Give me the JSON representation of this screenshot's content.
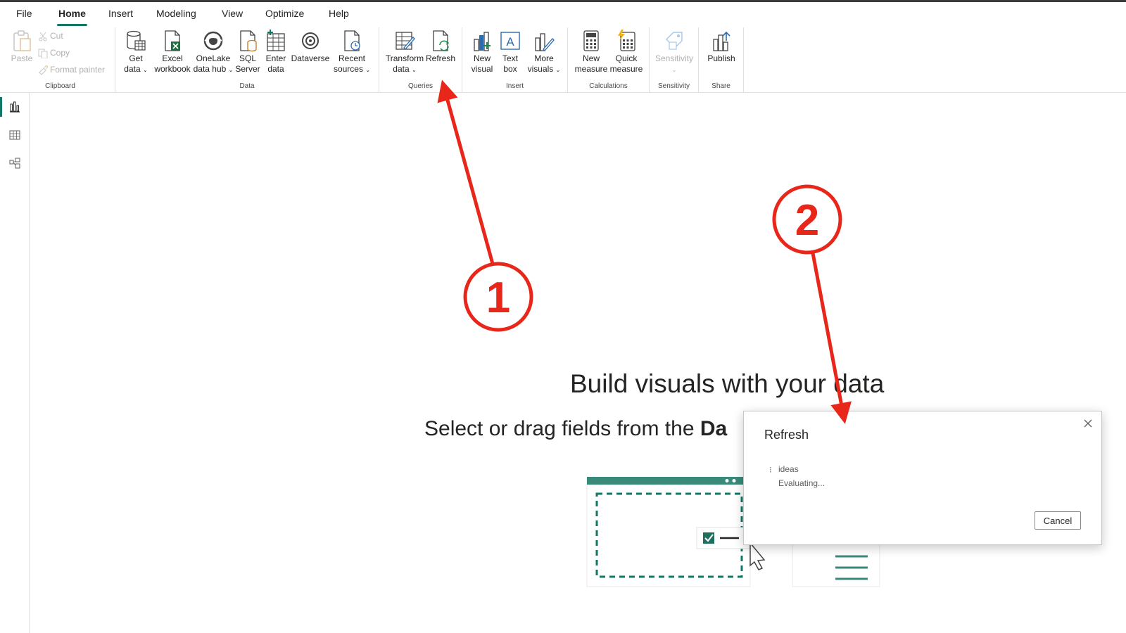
{
  "menu": {
    "tabs": [
      "File",
      "Home",
      "Insert",
      "Modeling",
      "View",
      "Optimize",
      "Help"
    ],
    "active": "Home"
  },
  "ribbon": {
    "clipboard": {
      "group": "Clipboard",
      "paste": "Paste",
      "cut": "Cut",
      "copy": "Copy",
      "format_painter": "Format painter"
    },
    "data": {
      "group": "Data",
      "get_data": [
        "Get",
        "data"
      ],
      "excel": [
        "Excel",
        "workbook"
      ],
      "onelake": [
        "OneLake",
        "data hub"
      ],
      "sql": [
        "SQL",
        "Server"
      ],
      "enter": [
        "Enter",
        "data"
      ],
      "dataverse": "Dataverse",
      "recent": [
        "Recent",
        "sources"
      ]
    },
    "queries": {
      "group": "Queries",
      "transform": [
        "Transform",
        "data"
      ],
      "refresh": "Refresh"
    },
    "insert": {
      "group": "Insert",
      "new_visual": [
        "New",
        "visual"
      ],
      "text_box": [
        "Text",
        "box"
      ],
      "more_visuals": [
        "More",
        "visuals"
      ]
    },
    "calculations": {
      "group": "Calculations",
      "new_measure": [
        "New",
        "measure"
      ],
      "quick_measure": [
        "Quick",
        "measure"
      ]
    },
    "sensitivity": {
      "group": "Sensitivity",
      "label": "Sensitivity"
    },
    "share": {
      "group": "Share",
      "publish": "Publish"
    }
  },
  "canvas": {
    "headline": "Build visuals with your data",
    "subline_prefix": "Select or drag fields from the ",
    "subline_bold": "Da"
  },
  "dialog": {
    "title": "Refresh",
    "spinner": "⁝",
    "query": "ideas",
    "status": "Evaluating...",
    "cancel": "Cancel"
  },
  "annotations": [
    "1",
    "2"
  ],
  "colors": {
    "accent": "#117865",
    "annotation": "#e8261a",
    "excel_green": "#1d6f42"
  }
}
